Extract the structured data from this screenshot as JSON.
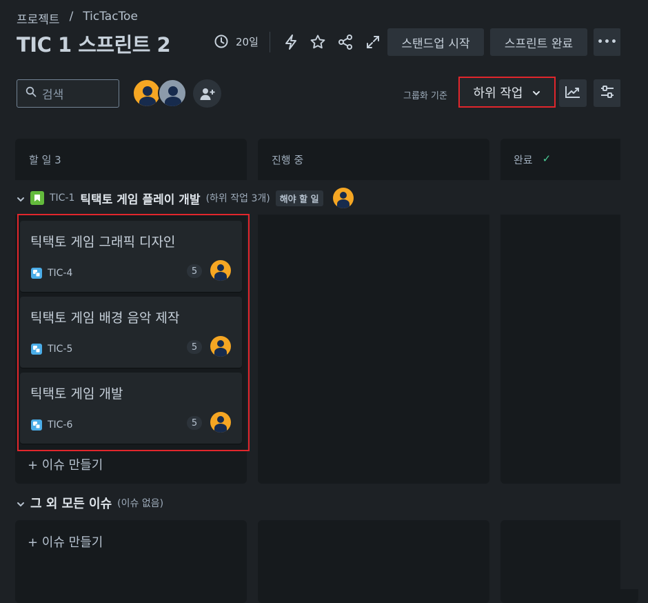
{
  "breadcrumb": {
    "project": "프로젝트",
    "separator": "/",
    "name": "TicTacToe"
  },
  "header": {
    "title": "TIC 1 스프린트 2",
    "days_remaining": "20일",
    "standup_button": "스탠드업 시작",
    "complete_button": "스프린트 완료",
    "more_label": "•••"
  },
  "toolbar": {
    "search_placeholder": "검색",
    "group_by_label": "그룹화 기준",
    "group_by_value": "하위 작업"
  },
  "columns": [
    {
      "name": "할 일 3"
    },
    {
      "name": "진행 중"
    },
    {
      "name": "완료",
      "check": "✓"
    }
  ],
  "swimlane": {
    "key": "TIC-1",
    "title": "틱택토 게임 플레이 개발",
    "subtask_count": "(하위 작업 3개)",
    "status": "해야 할 일"
  },
  "cards": [
    {
      "title": "틱택토 게임 그래픽 디자인",
      "key": "TIC-4",
      "points": "5"
    },
    {
      "title": "틱택토 게임 배경 음악 제작",
      "key": "TIC-5",
      "points": "5"
    },
    {
      "title": "틱택토 게임 개발",
      "key": "TIC-6",
      "points": "5"
    }
  ],
  "create_issue": "+ 이슈 만들기",
  "other_lane": {
    "title": "그 외 모든 이슈",
    "count": "(이슈 없음)"
  },
  "colors": {
    "accent_highlight": "#e2262c",
    "avatar": "#f5a623",
    "story": "#63ba3c",
    "subtask": "#4bade8",
    "done_check": "#4bce97"
  },
  "icons": [
    "clock-icon",
    "lightning-icon",
    "star-icon",
    "share-icon",
    "expand-icon",
    "search-icon",
    "add-person-icon",
    "chevron-down-icon",
    "insights-icon",
    "view-settings-icon",
    "story-icon",
    "subtask-icon",
    "check-icon"
  ]
}
